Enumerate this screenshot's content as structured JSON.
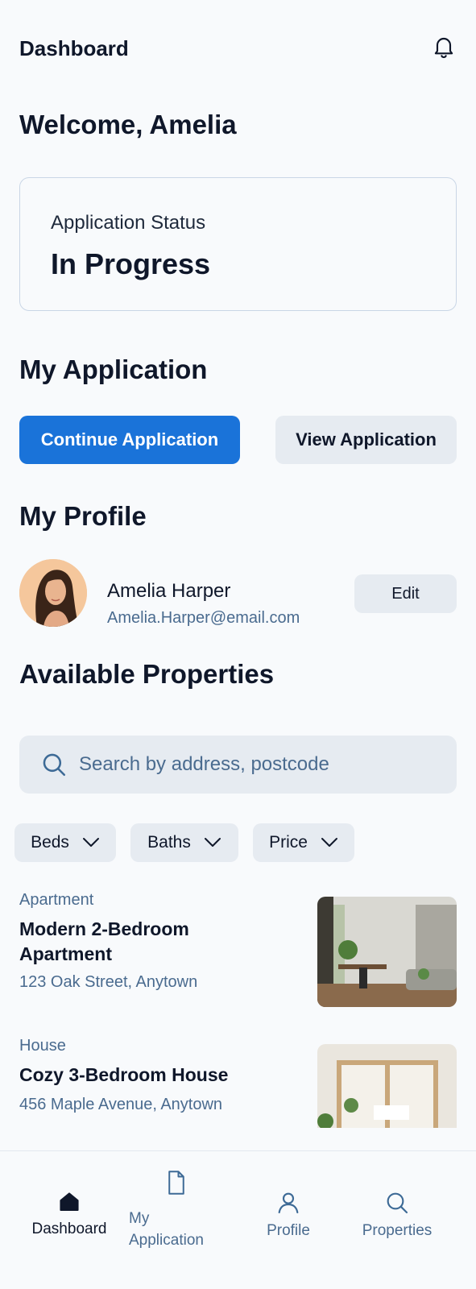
{
  "header": {
    "title": "Dashboard"
  },
  "welcome": "Welcome, Amelia",
  "status": {
    "label": "Application Status",
    "value": "In Progress"
  },
  "my_application": {
    "heading": "My Application",
    "continue_label": "Continue Application",
    "view_label": "View Application"
  },
  "profile": {
    "heading": "My Profile",
    "name": "Amelia Harper",
    "email": "Amelia.Harper@email.com",
    "edit_label": "Edit"
  },
  "properties": {
    "heading": "Available Properties",
    "search_placeholder": "Search by address, postcode",
    "filters": [
      {
        "label": "Beds"
      },
      {
        "label": "Baths"
      },
      {
        "label": "Price"
      }
    ],
    "items": [
      {
        "type": "Apartment",
        "name": "Modern 2-Bedroom Apartment",
        "address": "123 Oak Street, Anytown"
      },
      {
        "type": "House",
        "name": "Cozy 3-Bedroom House",
        "address": "456 Maple Avenue, Anytown"
      }
    ]
  },
  "nav": {
    "items": [
      {
        "label": "Dashboard",
        "icon": "home-icon",
        "active": true
      },
      {
        "label": "My Application",
        "icon": "document-icon",
        "active": false
      },
      {
        "label": "Profile",
        "icon": "user-icon",
        "active": false
      },
      {
        "label": "Properties",
        "icon": "search-icon",
        "active": false
      }
    ]
  },
  "colors": {
    "accent": "#1a73d9",
    "secondary_text": "#4a6b8f",
    "chip_bg": "#e6ebf1"
  }
}
